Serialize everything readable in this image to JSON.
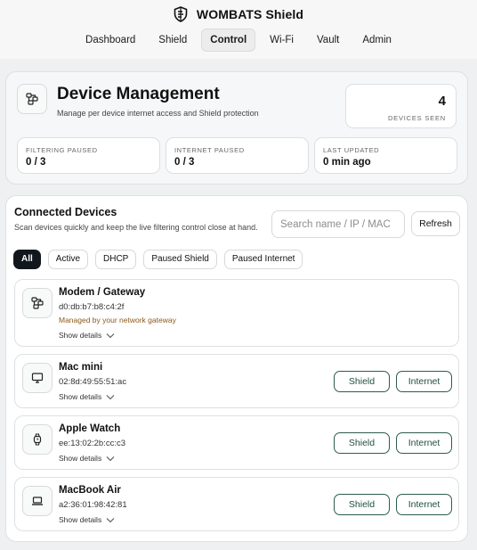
{
  "app": {
    "title": "WOMBATS Shield"
  },
  "nav": [
    {
      "label": "Dashboard"
    },
    {
      "label": "Shield"
    },
    {
      "label": "Control",
      "active": true
    },
    {
      "label": "Wi-Fi"
    },
    {
      "label": "Vault"
    },
    {
      "label": "Admin"
    }
  ],
  "management": {
    "title": "Device Management",
    "subtitle": "Manage per device internet access and Shield protection",
    "devices_seen_count": "4",
    "devices_seen_label": "DEVICES SEEN",
    "stats": [
      {
        "label": "FILTERING PAUSED",
        "value": "0 / 3"
      },
      {
        "label": "INTERNET PAUSED",
        "value": "0 / 3"
      },
      {
        "label": "LAST UPDATED",
        "value": "0 min ago"
      }
    ]
  },
  "connected": {
    "title": "Connected Devices",
    "subtitle": "Scan devices quickly and keep the live filtering control close at hand.",
    "search_placeholder": "Search name / IP / MAC",
    "search_value": "",
    "refresh_label": "Refresh",
    "filters": [
      {
        "label": "All",
        "active": true
      },
      {
        "label": "Active"
      },
      {
        "label": "DHCP"
      },
      {
        "label": "Paused Shield"
      },
      {
        "label": "Paused Internet"
      }
    ],
    "show_details_label": "Show details",
    "shield_label": "Shield",
    "internet_label": "Internet",
    "devices": [
      {
        "name": "Modem / Gateway",
        "mac": "d0:db:b7:b8:c4:2f",
        "note": "Managed by your network gateway",
        "icon": "network-icon"
      },
      {
        "name": "Mac mini",
        "mac": "02:8d:49:55:51:ac",
        "icon": "desktop-icon"
      },
      {
        "name": "Apple Watch",
        "mac": "ee:13:02:2b:cc:c3",
        "icon": "watch-icon"
      },
      {
        "name": "MacBook Air",
        "mac": "a2:36:01:98:42:81",
        "icon": "laptop-icon"
      }
    ]
  },
  "colors": {
    "accent_dark": "#12171d",
    "button_green": "#2c5d4b",
    "note_brown": "#8a5a1c"
  }
}
